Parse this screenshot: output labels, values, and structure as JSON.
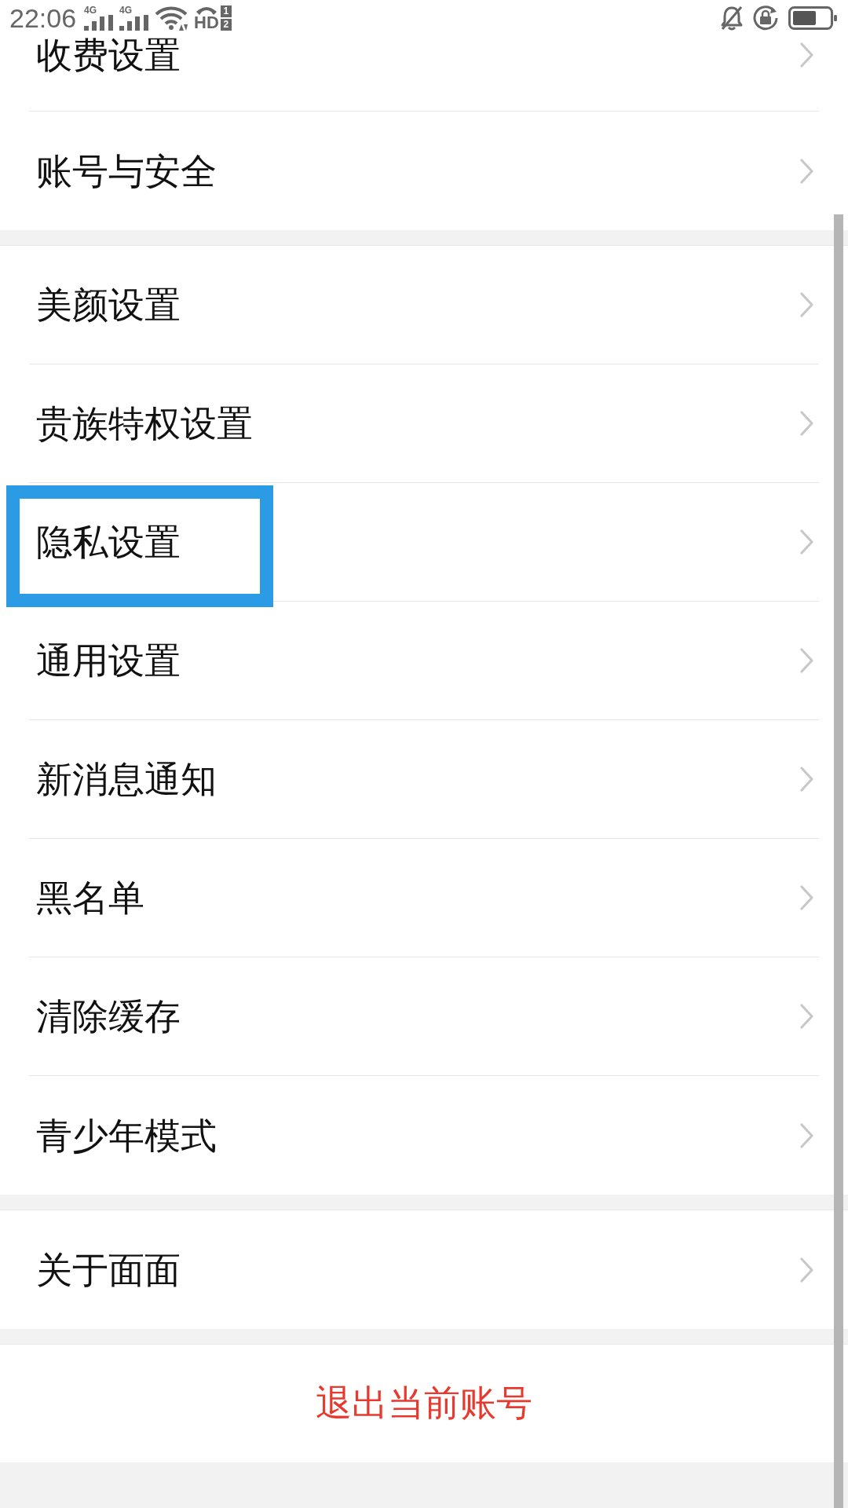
{
  "status_bar": {
    "time": "22:06",
    "signals": [
      {
        "label": "4G"
      },
      {
        "label": "4G"
      }
    ],
    "hd": {
      "label": "HD",
      "sims": [
        "1",
        "2"
      ]
    }
  },
  "sections": [
    {
      "items": [
        {
          "label": "收费设置",
          "highlighted": false
        },
        {
          "label": "账号与安全",
          "highlighted": false
        }
      ]
    },
    {
      "items": [
        {
          "label": "美颜设置",
          "highlighted": false
        },
        {
          "label": "贵族特权设置",
          "highlighted": false
        },
        {
          "label": "隐私设置",
          "highlighted": true
        },
        {
          "label": "通用设置",
          "highlighted": false
        },
        {
          "label": "新消息通知",
          "highlighted": false
        },
        {
          "label": "黑名单",
          "highlighted": false
        },
        {
          "label": "清除缓存",
          "highlighted": false
        },
        {
          "label": "青少年模式",
          "highlighted": false
        }
      ]
    },
    {
      "items": [
        {
          "label": "关于面面",
          "highlighted": false
        }
      ]
    }
  ],
  "logout_button": {
    "label": "退出当前账号"
  }
}
